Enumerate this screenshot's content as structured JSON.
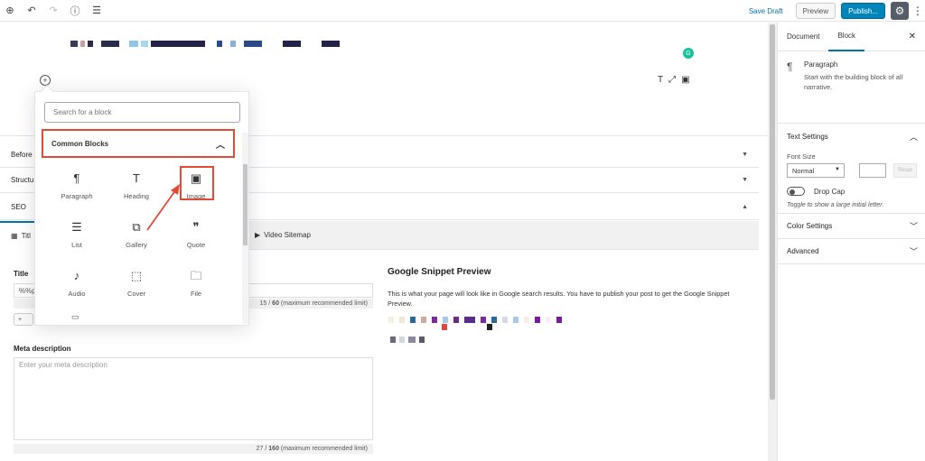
{
  "toolbar": {
    "save_draft": "Save Draft",
    "preview": "Preview",
    "publish": "Publish..."
  },
  "editor": {
    "panels": [
      {
        "label": "Before"
      },
      {
        "label": "Structu"
      },
      {
        "label": "SEO"
      }
    ],
    "seo_tabs": [
      {
        "label": "Titl"
      },
      {
        "label": "Video Sitemap"
      }
    ],
    "title_field": {
      "label": "Title",
      "value": "%%p",
      "counter_value": "15",
      "counter_max": "60",
      "counter_suffix": "(maximum recommended limit)"
    },
    "meta": {
      "label": "Meta description",
      "placeholder": "Enter your meta description",
      "counter_value": "27",
      "counter_max": "160",
      "counter_suffix": "(maximum recommended limit)"
    },
    "snippet": {
      "title": "Google Snippet Preview",
      "description": "This is what your page will look like in Google search results. You have to publish your post to get the Google Snippet Preview."
    }
  },
  "inserter": {
    "search_placeholder": "Search for a block",
    "category": "Common Blocks",
    "blocks": [
      {
        "label": "Paragraph",
        "icon": "paragraph-icon"
      },
      {
        "label": "Heading",
        "icon": "heading-icon"
      },
      {
        "label": "Image",
        "icon": "image-icon"
      },
      {
        "label": "List",
        "icon": "list-icon"
      },
      {
        "label": "Gallery",
        "icon": "gallery-icon"
      },
      {
        "label": "Quote",
        "icon": "quote-icon"
      },
      {
        "label": "Audio",
        "icon": "audio-icon"
      },
      {
        "label": "Cover",
        "icon": "cover-icon"
      },
      {
        "label": "File",
        "icon": "file-icon"
      }
    ],
    "highlight_color": "#e24a36"
  },
  "sidebar": {
    "tabs": [
      {
        "label": "Document"
      },
      {
        "label": "Block"
      }
    ],
    "block": {
      "name": "Paragraph",
      "description": "Start with the building block of all narrative."
    },
    "text_settings": {
      "title": "Text Settings",
      "font_size_label": "Font Size",
      "font_size_value": "Normal",
      "reset": "Reset",
      "drop_cap": "Drop Cap",
      "drop_cap_help": "Toggle to show a large initial letter."
    },
    "sections": [
      {
        "label": "Color Settings"
      },
      {
        "label": "Advanced"
      }
    ]
  },
  "colors": {
    "accent": "#0085ba",
    "link": "#0073aa"
  }
}
